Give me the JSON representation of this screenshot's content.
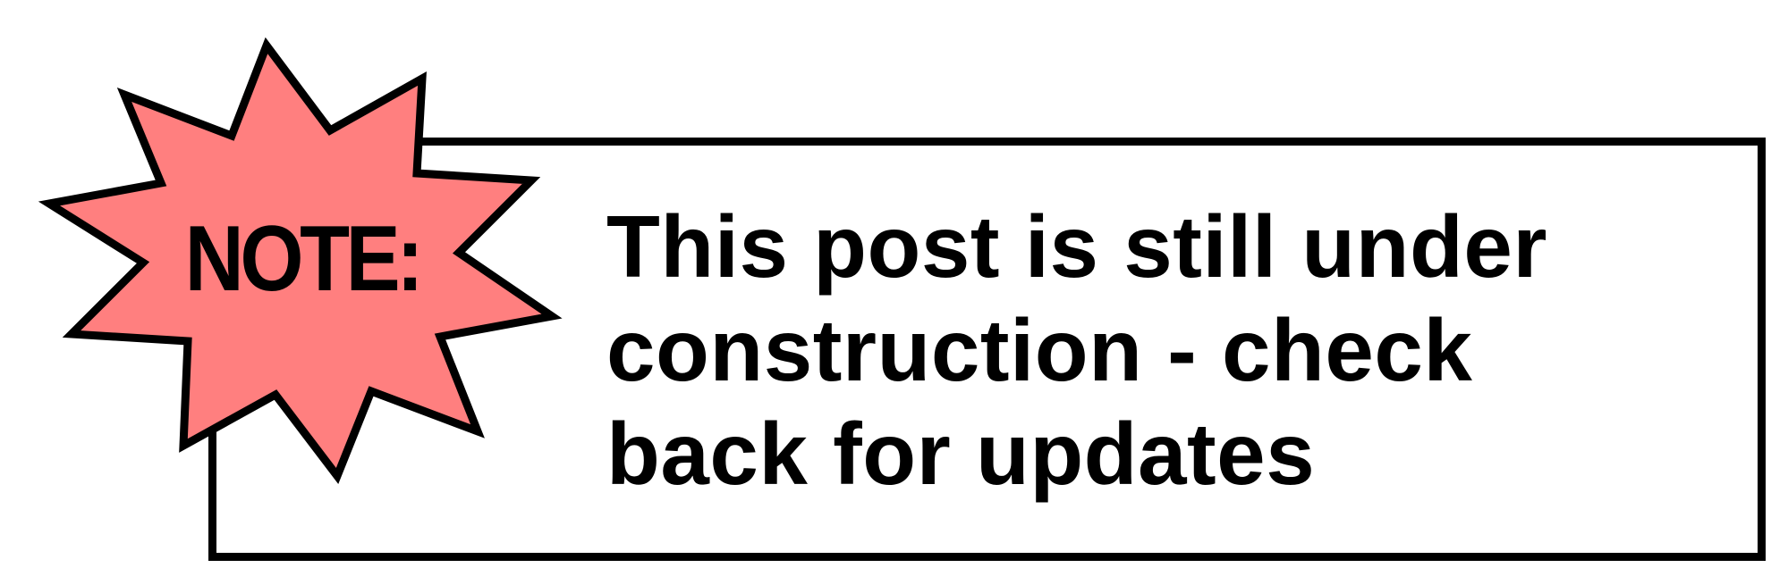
{
  "notice": {
    "badge_label": "NOTE:",
    "message": "This post is still under construction - check back for updates"
  },
  "colors": {
    "badge_fill": "#FF7F7F",
    "stroke": "#000000",
    "text": "#000000",
    "background": "#FFFFFF"
  },
  "icons": {
    "badge_shape": "starburst-icon"
  }
}
